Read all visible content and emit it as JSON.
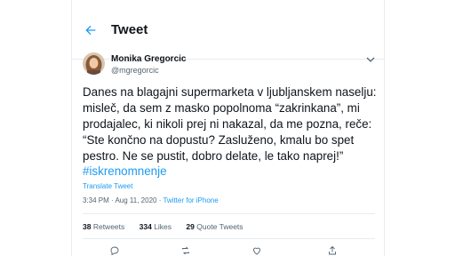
{
  "header": {
    "title": "Tweet"
  },
  "author": {
    "name": "Monika Gregorcic",
    "handle": "@mgregorcic"
  },
  "tweet": {
    "text": "Danes na blagajni supermarketa v ljubljanskem naselju:\nmisleč, da sem z masko popolnoma “zakrinkana”, mi\nprodajalec, ki nikoli prej ni nakazal, da me pozna, reče:\n“Ste končno na dopustu? Zasluženo, kmalu bo spet\npestro. Ne se pustit, dobro delate, le tako naprej!”",
    "hashtag": "#iskrenomnenje",
    "translate_label": "Translate Tweet",
    "time": "3:34 PM · Aug 11, 2020 · ",
    "source": "Twitter for iPhone"
  },
  "stats": {
    "retweets_count": "38",
    "retweets_label": " Retweets",
    "likes_count": "334",
    "likes_label": " Likes",
    "quotes_count": "29",
    "quotes_label": " Quote Tweets"
  },
  "icons": {
    "back": "arrow-left-icon",
    "caret": "chevron-down-icon",
    "reply": "reply-icon",
    "retweet": "retweet-icon",
    "like": "heart-icon",
    "share": "share-icon"
  },
  "colors": {
    "accent": "#1d9bf0",
    "text": "#0f1419",
    "secondary": "#536471",
    "border": "#e6ecf0"
  }
}
